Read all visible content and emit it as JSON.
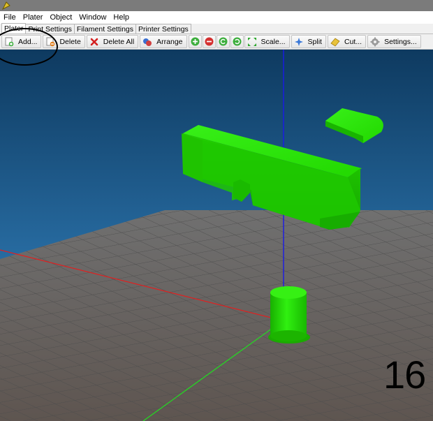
{
  "menu": {
    "items": [
      "File",
      "Plater",
      "Object",
      "Window",
      "Help"
    ]
  },
  "tabs": [
    "Plater",
    "Print Settings",
    "Filament Settings",
    "Printer Settings"
  ],
  "toolbar": {
    "add": "Add...",
    "delete": "Delete",
    "delete_all": "Delete All",
    "arrange": "Arrange",
    "scale": "Scale...",
    "split": "Split",
    "cut": "Cut...",
    "settings": "Settings..."
  },
  "viewport": {
    "annotation_number": "16"
  },
  "colors": {
    "model": "#22e000",
    "bed": "#6e6e6e",
    "background_top": "#0f3d63",
    "background_bottom": "#3a8fd0"
  }
}
